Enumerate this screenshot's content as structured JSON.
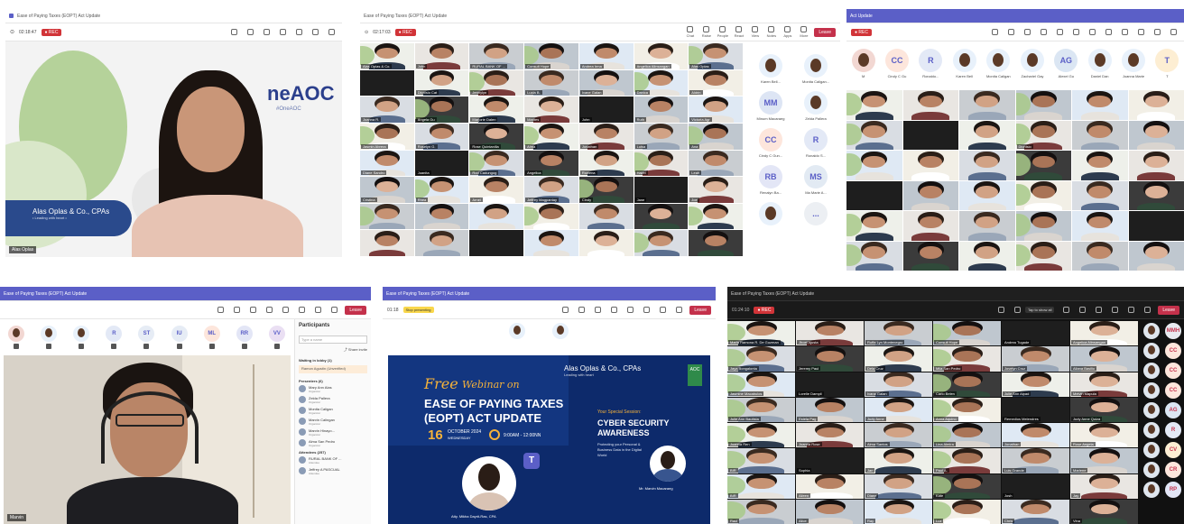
{
  "meeting_title": "Ease of Paying Taxes (EOPT) Act Update",
  "panel1": {
    "title": "Ease of Paying Taxes (EOPT) Act Update",
    "timer": "02:18:47",
    "leave": "Leave",
    "logo_text": "neAOC",
    "logo_sub": "#OneAOC",
    "firm": "Alas Oplas & Co., CPAs",
    "firm_sub": "• Leading with heart •",
    "name_tag": "Alas Oplas"
  },
  "panel2": {
    "title": "Ease of Paying Taxes (EOPT) Act Update",
    "timer": "02:17:03",
    "leave": "Leave",
    "toolbar": [
      "Chat",
      "Raise",
      "People",
      "React",
      "View",
      "Notes",
      "Apps",
      "More"
    ],
    "tiles": [
      "Alas Oplas & Co.",
      "John",
      "RURAL BANK OF ...",
      "Consult Hope",
      "Andrea Irma",
      "Angelica Alinsangan",
      "Alas Oplas",
      "",
      "Dionisio Cat",
      "Jennylyn",
      "Lucia B.",
      "Ivane Galan",
      "Danica",
      "Aldrin",
      "Joanna R.",
      "Angela Gu",
      "Marjorie Dalen",
      "Marites",
      "John",
      "Ruth",
      "Victoria Agr",
      "Jasmin Abrera",
      "Roselyn G.",
      "Rose Quintanilla",
      "Alma",
      "Jonathan",
      "Luisa",
      "Ana",
      "Diane Sandro",
      "Juanita",
      "Rod Cadungog",
      "Angelica",
      "Rowena",
      "Hazel",
      "Leah",
      "Cristina",
      "Rhea",
      "Arnel",
      "Jeffrey Magpantay",
      "Cindy",
      "Jane",
      "Joe"
    ],
    "side": [
      {
        "label": "Karen Bell...",
        "initials": "",
        "color": "#e8f1fb"
      },
      {
        "label": "Monita Caligan...",
        "initials": "",
        "color": "#e8f1fb"
      },
      {
        "label": "Minum Macaraeg",
        "initials": "MM",
        "color": "#dde5f4"
      },
      {
        "label": "Zelda Pallera",
        "initials": "",
        "color": "#e8f1fb"
      },
      {
        "label": "Cindy C Gun...",
        "initials": "CC",
        "color": "#fde6dc"
      },
      {
        "label": "Ronaldo S...",
        "initials": "R",
        "color": "#e3e9f6"
      },
      {
        "label": "Renalyn Ba...",
        "initials": "RB",
        "color": "#e3e6f6"
      },
      {
        "label": "Ma Marie A...",
        "initials": "MS",
        "color": "#e2eaf3"
      },
      {
        "label": "",
        "initials": "",
        "color": "#e8f1fb"
      },
      {
        "label": "",
        "initials": "...",
        "color": "#eceff3"
      }
    ]
  },
  "panel3": {
    "title": "Act Update",
    "leave": "Leave",
    "avatars": [
      {
        "initials": "",
        "color": "#f2d7d2"
      },
      {
        "initials": "CC",
        "color": "#fde6dc"
      },
      {
        "initials": "R",
        "color": "#e3e9f6"
      },
      {
        "initials": "",
        "color": "#e8f1fb"
      },
      {
        "initials": "",
        "color": "#e8f1fb"
      },
      {
        "initials": "",
        "color": "#e8f1fb"
      },
      {
        "initials": "AG",
        "color": "#dbe6f3"
      },
      {
        "initials": "",
        "color": "#e8f1fb"
      },
      {
        "initials": "",
        "color": "#e8f1fb"
      },
      {
        "initials": "T",
        "color": "#fdeed3"
      }
    ],
    "avatar_labels": [
      "M",
      "Cindy C Gu",
      "Ronaldo...",
      "Karen Bell",
      "Monita Caligan",
      "Zachariel Gay",
      "Alexel Gu",
      "Daniel Dan",
      "Joanna Marie",
      "T"
    ],
    "tiles": [
      "",
      "",
      "",
      "",
      "",
      "",
      "",
      "",
      "",
      "Dionisio",
      "",
      "",
      "",
      "",
      "",
      "",
      "",
      "",
      "",
      "",
      "",
      "",
      "",
      "",
      "",
      "",
      "",
      "",
      "",
      "",
      "",
      "",
      "",
      "",
      "",
      ""
    ]
  },
  "panel4": {
    "title": "Ease of Paying Taxes (EOPT) Act Update",
    "leave": "Leave",
    "avatar_initials": [
      "",
      "",
      "",
      "R",
      "ST",
      "IU",
      "ML",
      "RR",
      "VV"
    ],
    "avatar_colors": [
      "#f2d7d2",
      "#e8f1fb",
      "#e8f1fb",
      "#e3e9f6",
      "#e6ecf5",
      "#e6ecf5",
      "#fde6dc",
      "#e3e6f6",
      "#eadff3"
    ],
    "side_title": "Participants",
    "search_placeholder": "Type a name",
    "share_invite": "Share invite",
    "waiting": "Waiting in lobby (1)",
    "presenters": "Presenters (6)",
    "attendees": "Attendees (257)",
    "people": [
      {
        "name": "Mary Ann Alas",
        "role": "Organizer"
      },
      {
        "name": "Zelda Pallera",
        "role": "Organizer"
      },
      {
        "name": "Monita Caligan",
        "role": "Organizer"
      },
      {
        "name": "Marvin Calingan",
        "role": "Organizer"
      },
      {
        "name": "Marvin Hinayo...",
        "role": "Organizer"
      },
      {
        "name": "Alma San Pedro",
        "role": "Organizer"
      },
      {
        "name": "RURAL BANK OF ...",
        "role": "Attendee"
      },
      {
        "name": "Jeffrey A PASCUAL",
        "role": "Attendee"
      }
    ],
    "badge": "Unmuted",
    "name_tag": "Marvin"
  },
  "panel5": {
    "title": "Ease of Paying Taxes (EOPT) Act Update",
    "timer": "01:18",
    "sharing": "Stop presenting",
    "leave": "Leave",
    "firm": "Alas Oplas & Co., CPAs",
    "firm_sub": "Leading with heart",
    "free": "Free",
    "webinar": "Webinar on",
    "headline1": "EASE OF PAYING TAXES",
    "headline2": "(EOPT) ACT UPDATE",
    "day": "16",
    "month": "OCTOBER 2024",
    "weekday": "WEDNESDAY",
    "time": "9:00AM - 12:00NN",
    "special": "Your Special Session:",
    "session1": "CYBER SECURITY",
    "session2": "AWARENESS",
    "session_desc": "Protecting your Personal & Business Data in the Digital World",
    "speaker": "Atty. Mikha Dayrit-Ras, CPA",
    "speaker2": "Mr. Marvin Macaraeg",
    "aoc": "AOC",
    "teams": "T"
  },
  "panel6": {
    "title": "Ease of Paying Taxes (EOPT) Act Update",
    "timer": "01:24:10",
    "leave": "Leave",
    "tooltip": "Tap to show all",
    "tiles": [
      "Maria Ramona R. De Guzman",
      "Jhoel Ajusta",
      "Ruffa Lyn Montenegro",
      "Consult Hope",
      "Andrea Tugade",
      "Angelica Alinsangan",
      "Jaya Bongalonta",
      "Jeremy Paul",
      "Dela Cruz",
      "Mila San Pedro",
      "Jovelyn Cruz",
      "Allana Basilio",
      "Jasmine Macabulos",
      "Lorelie Dampil",
      "Ivana Galan",
      "Carlo Belen",
      "Julie Ann Alpad",
      "Melvin Mapula",
      "Julie Ann Bautista",
      "Estela Pag",
      "Judy Anne",
      "Anna Aquino",
      "Remedios Melendres",
      "Judy Anne Quiza",
      "Joanna Ren",
      "Joanna Rose",
      "Alma Santos",
      "Lina Almira",
      "Jonathan",
      "Rose Angela",
      "BIR",
      "Sophia",
      "Jan",
      "Paul A.",
      "Luis Grande",
      "Marlene",
      "BIR",
      "Aileen",
      "Diane",
      "Kate",
      "Josh",
      "Jay",
      "Raul",
      "Alice",
      "Ray",
      "Luz",
      "Chris",
      "Vina"
    ],
    "roster": [
      {
        "initials": "",
        "color": "#dfe6ee"
      },
      {
        "initials": "MMH",
        "color": "#e8eaf0"
      },
      {
        "initials": "",
        "color": "#dfe6ee"
      },
      {
        "initials": "CC",
        "color": "#fde6dc"
      },
      {
        "initials": "",
        "color": "#dfe6ee"
      },
      {
        "initials": "CC",
        "color": "#fde6dc"
      },
      {
        "initials": "",
        "color": "#dfe6ee"
      },
      {
        "initials": "CC",
        "color": "#fde6dc"
      },
      {
        "initials": "",
        "color": "#dfe6ee"
      },
      {
        "initials": "AG",
        "color": "#dbe6f3"
      },
      {
        "initials": "",
        "color": "#dfe6ee"
      },
      {
        "initials": "R",
        "color": "#e3e9f6"
      },
      {
        "initials": "",
        "color": "#dfe6ee"
      },
      {
        "initials": "CV",
        "color": "#fdeed3"
      },
      {
        "initials": "",
        "color": "#dfe6ee"
      },
      {
        "initials": "CR",
        "color": "#fde6dc"
      },
      {
        "initials": "",
        "color": "#dfe6ee"
      },
      {
        "initials": "RP",
        "color": "#e3e6f6"
      }
    ]
  },
  "colors": {
    "accent": "#5b5fc7",
    "danger": "#c4314b",
    "leaf": "#a8c98a",
    "navy": "#0d2a6b"
  }
}
